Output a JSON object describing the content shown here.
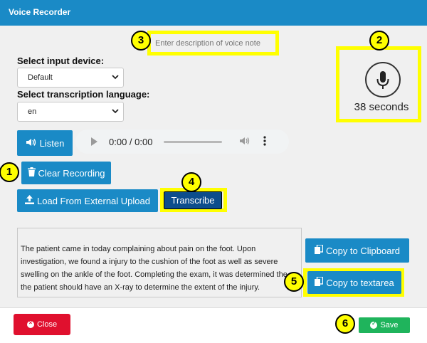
{
  "window": {
    "title": "Voice Recorder"
  },
  "description": {
    "placeholder": "Enter description of voice note"
  },
  "input_device": {
    "label": "Select input device:",
    "value": "Default"
  },
  "language": {
    "label": "Select transcription language:",
    "value": "en"
  },
  "buttons": {
    "listen": "Listen",
    "clear": "Clear Recording",
    "load": "Load From External Upload",
    "transcribe": "Transcribe",
    "copy_clipboard": "Copy to Clipboard",
    "copy_textarea": "Copy to textarea",
    "close": "Close",
    "save": "Save"
  },
  "audio": {
    "time": "0:00 / 0:00"
  },
  "recorder": {
    "duration": "38 seconds"
  },
  "transcript": {
    "text": "The patient came in today complaining about pain on the foot. Upon investigation, we found a injury to the cushion of the foot as well as severe swelling on the ankle of the foot. Completing the exam, it was determined the the patient should have an X-ray to determine the extent of the injury."
  },
  "annotations": [
    "1",
    "2",
    "3",
    "4",
    "5",
    "6"
  ],
  "colors": {
    "titlebar": "#1a8ac6",
    "button": "#1a8ac6",
    "transcribe": "#0d4d8c",
    "close": "#e0102e",
    "save": "#1fb45c",
    "highlight": "#ffff00"
  }
}
